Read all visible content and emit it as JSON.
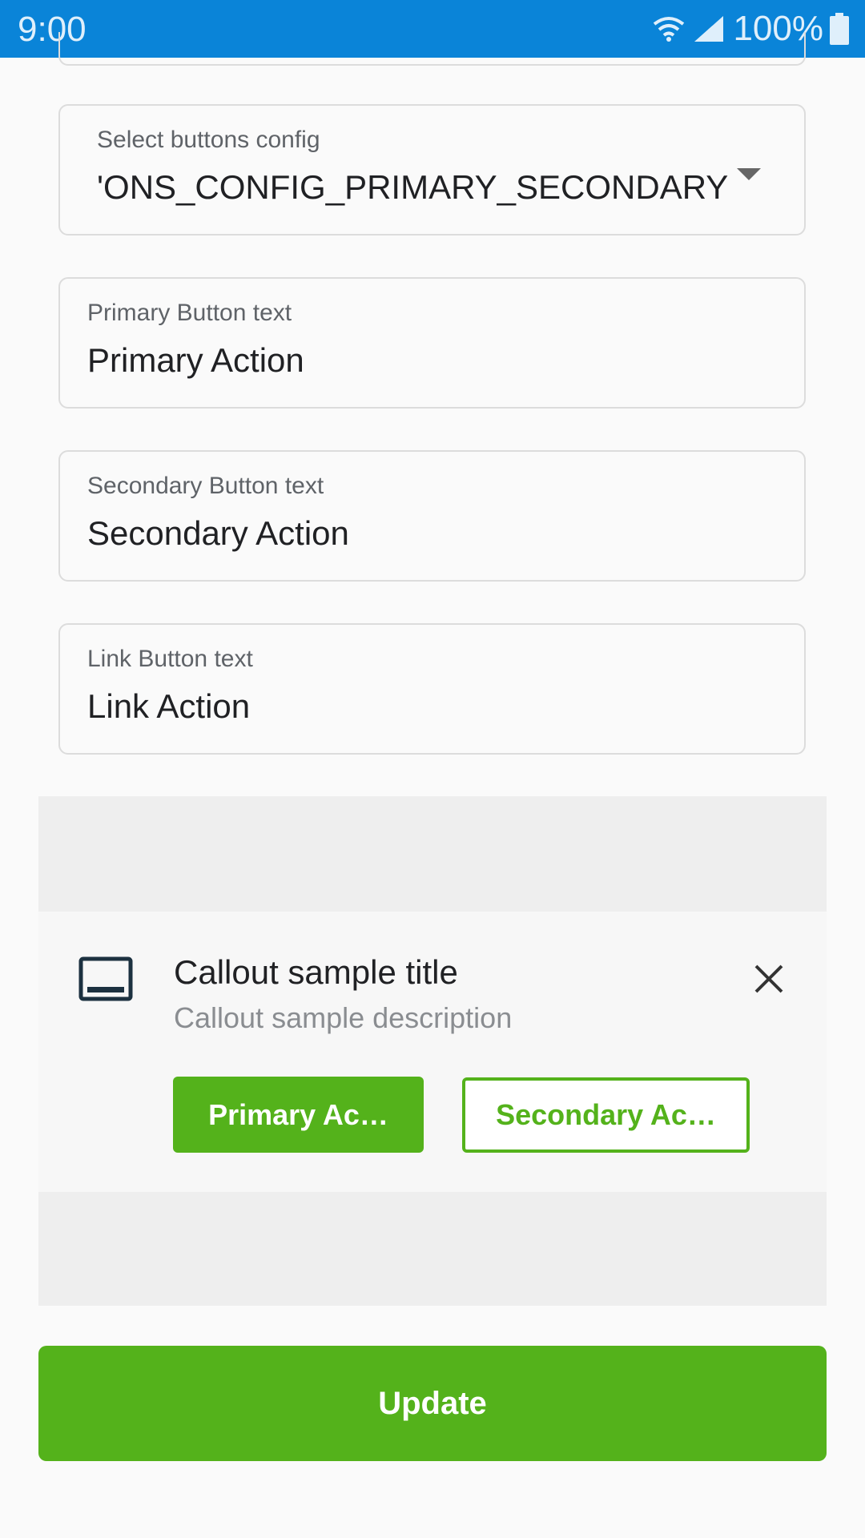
{
  "status_bar": {
    "time": "9:00",
    "battery_percent": "100%",
    "icons": [
      "wifi-icon",
      "cell-signal-icon",
      "battery-icon"
    ]
  },
  "form": {
    "buttons_config": {
      "label": "Select buttons config",
      "value": "'ONS_CONFIG_PRIMARY_SECONDARY"
    },
    "primary_text": {
      "label": "Primary Button text",
      "value": "Primary Action"
    },
    "secondary_text": {
      "label": "Secondary Button text",
      "value": "Secondary Action"
    },
    "link_text": {
      "label": "Link Button text",
      "value": "Link Action"
    }
  },
  "callout": {
    "icon": "callout-icon",
    "title": "Callout sample title",
    "description": "Callout sample description",
    "primary_button": "Primary Ac…",
    "secondary_button": "Secondary Ac…",
    "close_icon": "close-icon"
  },
  "update_button": "Update",
  "colors": {
    "status_bar": "#0a84d8",
    "accent_green": "#54b21b",
    "field_border": "#dcdcdc"
  }
}
